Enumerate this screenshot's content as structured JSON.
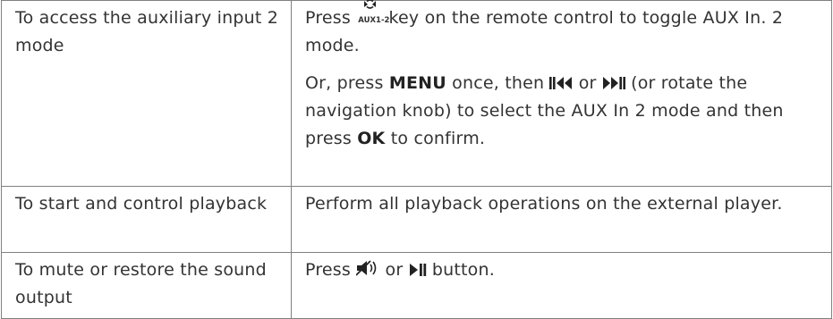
{
  "rows": [
    {
      "task": "To access the auxiliary input 2 mode",
      "p1": {
        "press": "Press",
        "key_label": "AUX1-2",
        "rest": "key on the remote control to toggle AUX In. 2 mode."
      },
      "p2": {
        "t1": "Or, press",
        "menu": "MENU",
        "t2": "once, then",
        "t3": "or",
        "t4": "(or rotate the navigation knob) to select the AUX In 2 mode and then press",
        "ok": "OK",
        "t5": "to confirm."
      }
    },
    {
      "task": "To start and control playback",
      "action": "Perform all playback operations on the external player."
    },
    {
      "task": "To mute or restore the sound output",
      "t1": "Press",
      "t2": "or",
      "t3": "button."
    }
  ],
  "icons": [
    "aux-toggle-icon",
    "previous-track-icon",
    "next-track-icon",
    "mute-icon",
    "play-pause-icon"
  ]
}
